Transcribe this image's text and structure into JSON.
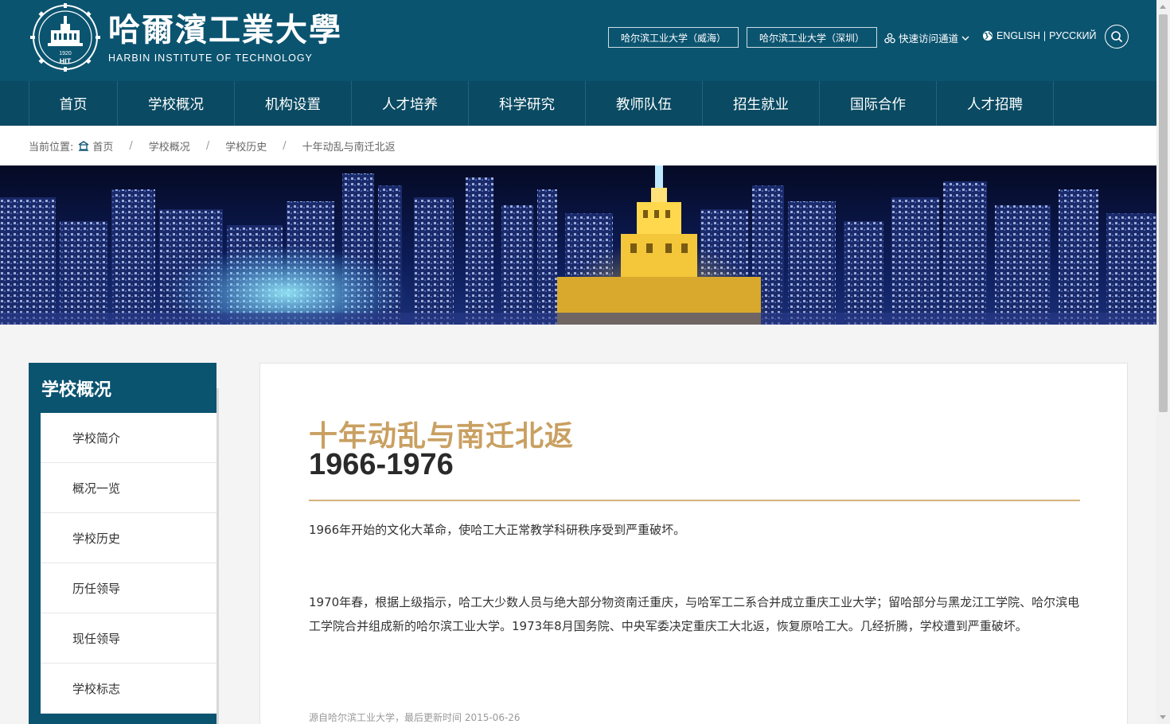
{
  "header": {
    "logo_cn": "哈爾濱工業大學",
    "logo_en": "HARBIN INSTITUTE OF TECHNOLOGY",
    "emblem_year": "1920",
    "emblem_abbr": "HIT",
    "btn_weihai": "哈尔滨工业大学（威海）",
    "btn_shenzhen": "哈尔滨工业大学（深圳）",
    "quick_access": "快速访问通道",
    "lang_en": "ENGLISH",
    "lang_sep": "|",
    "lang_ru": "РУССКИЙ"
  },
  "nav": {
    "items": [
      {
        "label": "首页"
      },
      {
        "label": "学校概况"
      },
      {
        "label": "机构设置"
      },
      {
        "label": "人才培养"
      },
      {
        "label": "科学研究"
      },
      {
        "label": "教师队伍"
      },
      {
        "label": "招生就业"
      },
      {
        "label": "国际合作"
      },
      {
        "label": "人才招聘"
      }
    ]
  },
  "breadcrumb": {
    "prefix": "当前位置:",
    "items": [
      "首页",
      "学校概况",
      "学校历史",
      "十年动乱与南迁北返"
    ],
    "separator": "/"
  },
  "sidebar": {
    "title": "学校概况",
    "items": [
      {
        "label": "学校简介"
      },
      {
        "label": "概况一览"
      },
      {
        "label": "学校历史"
      },
      {
        "label": "历任领导"
      },
      {
        "label": "现任领导"
      },
      {
        "label": "学校标志"
      }
    ]
  },
  "article": {
    "title": "十年动乱与南迁北返",
    "years": "1966-1976",
    "p1": "1966年开始的文化大革命，使哈工大正常教学科研秩序受到严重破坏。",
    "p2": "1970年春，根据上级指示，哈工大少数人员与绝大部分物资南迁重庆，与哈军工二系合并成立重庆工业大学；留哈部分与黑龙江工学院、哈尔滨电工学院合并组成新的哈尔滨工业大学。1973年8月国务院、中央军委决定重庆工大北返，恢复原哈工大。几经折腾，学校遭到严重破坏。",
    "meta": "源自哈尔滨工业大学，最后更新时间 2015-06-26"
  },
  "colors": {
    "header_bg": "#0b5470",
    "nav_bg": "#0a4a62",
    "accent_gold": "#c9a062"
  }
}
